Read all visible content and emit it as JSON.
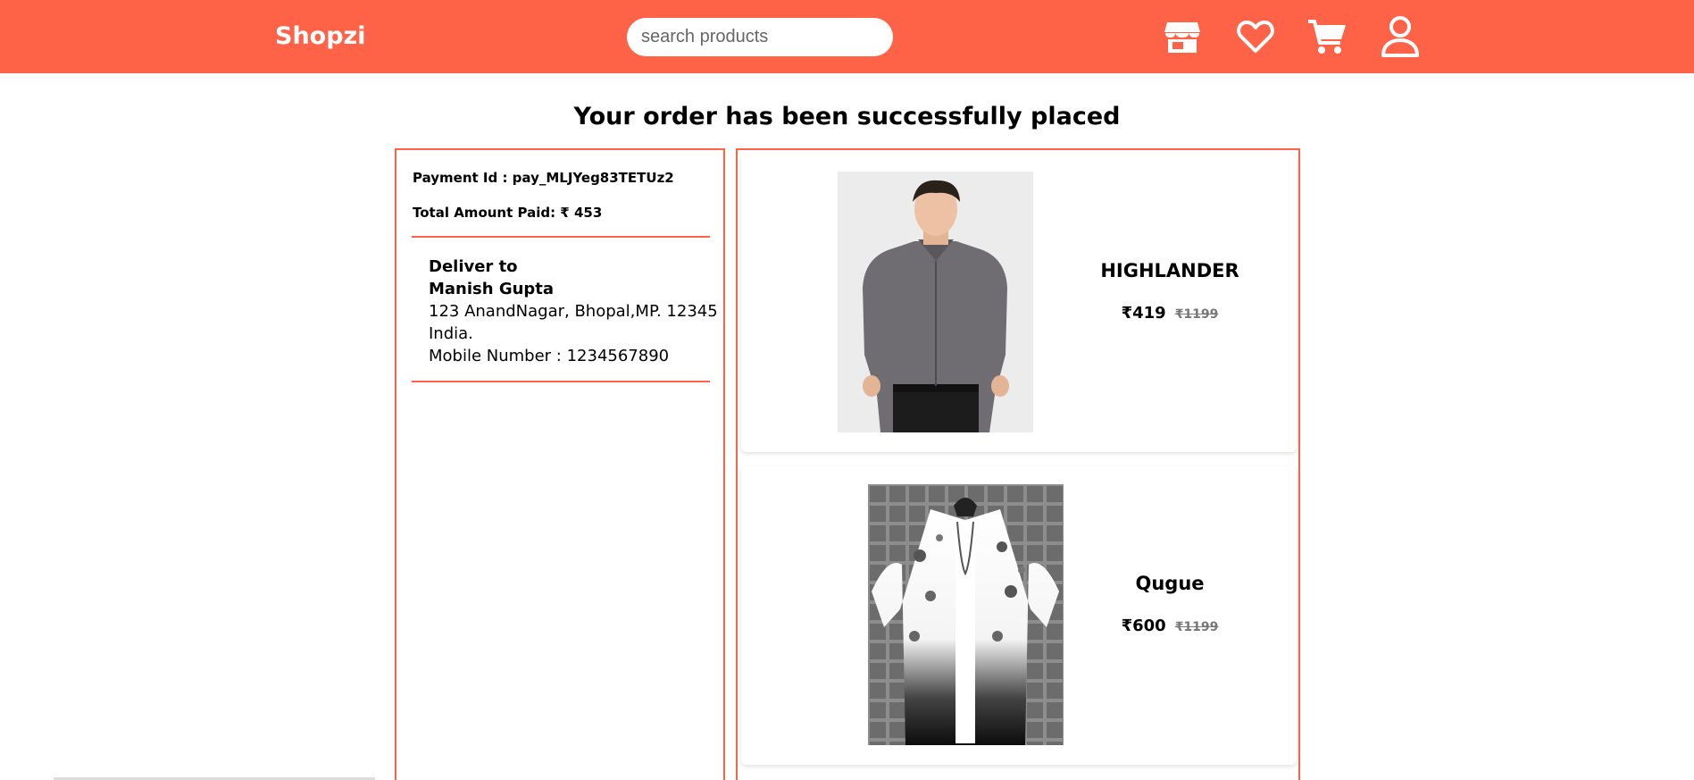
{
  "header": {
    "logo": "Shopzi",
    "search_placeholder": "search products",
    "icons": [
      "store-icon",
      "heart-icon",
      "cart-icon",
      "user-icon"
    ]
  },
  "page": {
    "title": "Your order has been successfully placed"
  },
  "payment": {
    "id_line": "Payment Id : pay_MLJYeg83TETUz2",
    "total_line": "Total Amount Paid: ₹ 453"
  },
  "delivery": {
    "label": "Deliver to",
    "name": "Manish Gupta",
    "address": "123 AnandNagar, Bhopal,MP. 12345",
    "country": "India.",
    "mobile": "Mobile Number : 1234567890"
  },
  "items": [
    {
      "brand": "HIGHLANDER",
      "price": "₹419",
      "mrp": "₹1199",
      "image": "grey-shirt-image"
    },
    {
      "brand": "Qugue",
      "price": "₹600",
      "mrp": "₹1199",
      "image": "floral-shirt-image"
    }
  ],
  "colors": {
    "accent": "#ff6347"
  }
}
